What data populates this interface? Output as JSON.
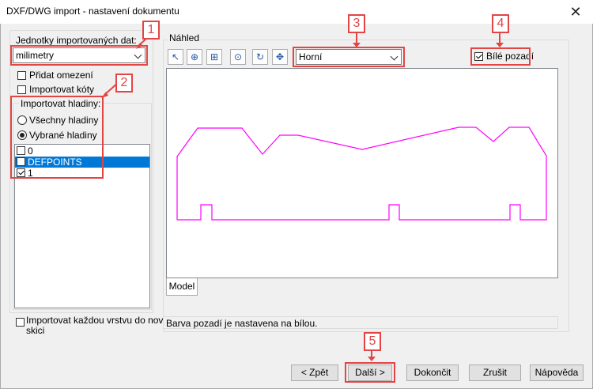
{
  "window": {
    "title": "DXF/DWG import - nastavení dokumentu",
    "close_glyph": "✕"
  },
  "units": {
    "label": "Jednotky importovaných dat:",
    "value": "milimetry"
  },
  "options": {
    "add_constraints": "Přidat omezení",
    "import_dimensions": "Importovat kóty"
  },
  "layers": {
    "group_label": "Importovat hladiny:",
    "all_layers": "Všechny hladiny",
    "selected_layers": "Vybrané hladiny",
    "items": [
      {
        "label": "0",
        "checked": false,
        "selected": false
      },
      {
        "label": "DEFPOINTS",
        "checked": false,
        "selected": true
      },
      {
        "label": "1",
        "checked": true,
        "selected": false
      }
    ]
  },
  "import_each_layer": {
    "line1": "Importovat každou vrstvu do nové",
    "line2": "skici"
  },
  "preview": {
    "label": "Náhled",
    "view_value": "Horní",
    "white_background": "Bílé pozadí",
    "tab": "Model",
    "status": "Barva pozadí je nastavena na bílou.",
    "toolbar_icons": [
      "select-icon",
      "zoom-in-icon",
      "zoom-window-icon",
      "zoom-fit-icon",
      "refresh-icon",
      "pan-icon"
    ],
    "outline_color": "#ff00ff"
  },
  "callouts": [
    "1",
    "2",
    "3",
    "4",
    "5"
  ],
  "buttons": {
    "back": "< Zpět",
    "next": "Další >",
    "finish": "Dokončit",
    "cancel": "Zrušit",
    "help": "Nápověda"
  },
  "colors": {
    "accent_red": "#e34545",
    "selection_blue": "#0078d7"
  }
}
